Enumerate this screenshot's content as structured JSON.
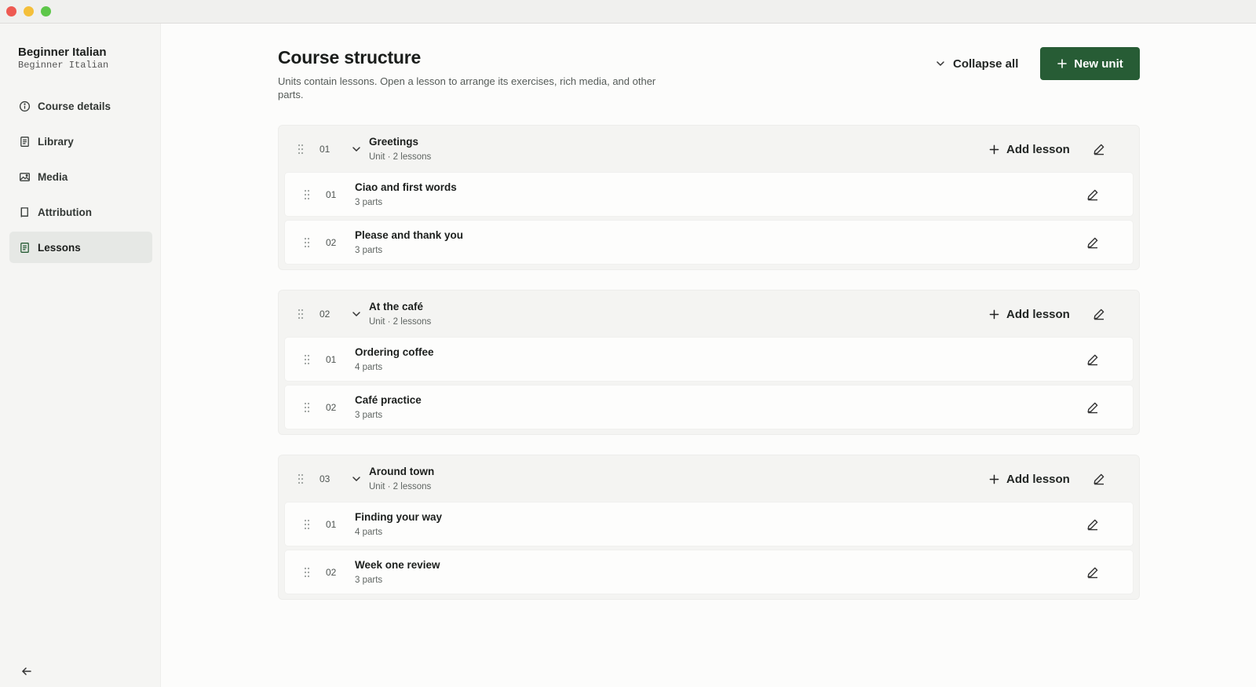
{
  "window": {
    "controls": [
      "close",
      "minimize",
      "zoom"
    ]
  },
  "sidebar": {
    "course_title": "Beginner Italian",
    "course_subtitle": "Beginner Italian",
    "items": [
      {
        "label": "Course details",
        "icon": "info-icon"
      },
      {
        "label": "Library",
        "icon": "document-icon"
      },
      {
        "label": "Media",
        "icon": "image-icon"
      },
      {
        "label": "Attribution",
        "icon": "book-icon"
      },
      {
        "label": "Lessons",
        "icon": "lessons-icon",
        "active": true
      }
    ],
    "collapse_icon": "arrow-left-icon"
  },
  "header": {
    "title": "Course structure",
    "description": "Units contain lessons. Open a lesson to arrange its exercises, rich media, and other parts.",
    "collapse_all_label": "Collapse all",
    "new_unit_label": "New unit"
  },
  "colors": {
    "accent": "#275c35",
    "background": "#fcfcfb",
    "sidebar": "#f5f5f3"
  },
  "units": [
    {
      "number": "01",
      "name": "Greetings",
      "meta": "Unit · 2 lessons",
      "add_label": "Add lesson",
      "lessons": [
        {
          "number": "01",
          "name": "Ciao and first words",
          "meta": "3 parts"
        },
        {
          "number": "02",
          "name": "Please and thank you",
          "meta": "3 parts"
        }
      ]
    },
    {
      "number": "02",
      "name": "At the café",
      "meta": "Unit · 2 lessons",
      "add_label": "Add lesson",
      "lessons": [
        {
          "number": "01",
          "name": "Ordering coffee",
          "meta": "4 parts"
        },
        {
          "number": "02",
          "name": "Café practice",
          "meta": "3 parts"
        }
      ]
    },
    {
      "number": "03",
      "name": "Around town",
      "meta": "Unit · 2 lessons",
      "add_label": "Add lesson",
      "lessons": [
        {
          "number": "01",
          "name": "Finding your way",
          "meta": "4 parts"
        },
        {
          "number": "02",
          "name": "Week one review",
          "meta": "3 parts"
        }
      ]
    }
  ]
}
